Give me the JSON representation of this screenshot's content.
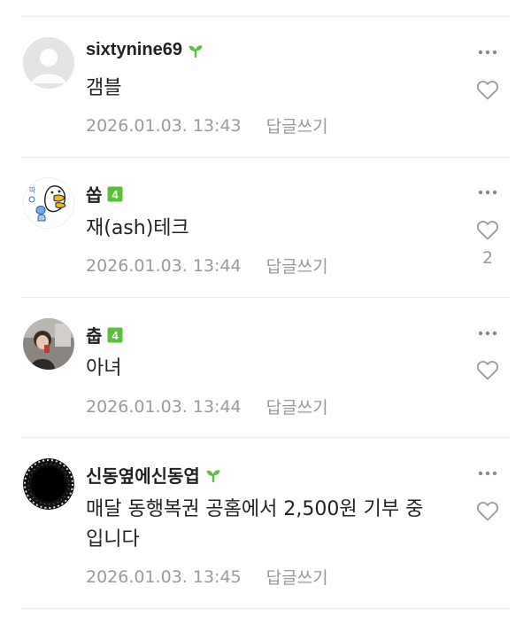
{
  "comments": [
    {
      "author": "sixtynine69",
      "badge": "sprout-icon",
      "text": "갬블",
      "date": "2026.01.03. 13:43",
      "reply_label": "답글쓰기",
      "like_count": ""
    },
    {
      "author": "쏩",
      "badge": "level-4-icon",
      "text": "재(ash)테크",
      "date": "2026.01.03. 13:44",
      "reply_label": "답글쓰기",
      "like_count": "2"
    },
    {
      "author": "춥",
      "badge": "level-4-icon",
      "text": "아녀",
      "date": "2026.01.03. 13:44",
      "reply_label": "답글쓰기",
      "like_count": ""
    },
    {
      "author": "신동옆에신동엽",
      "badge": "sprout-icon",
      "text_line1": "매달 동행복권 공홈에서 2,500원 기부 중",
      "text_line2": "입니다",
      "date": "2026.01.03. 13:45",
      "reply_label": "답글쓰기",
      "like_count": ""
    }
  ],
  "colors": {
    "badge_green": "#5bbf3a",
    "meta_gray": "#9a9a9a",
    "divider": "#ececec"
  }
}
